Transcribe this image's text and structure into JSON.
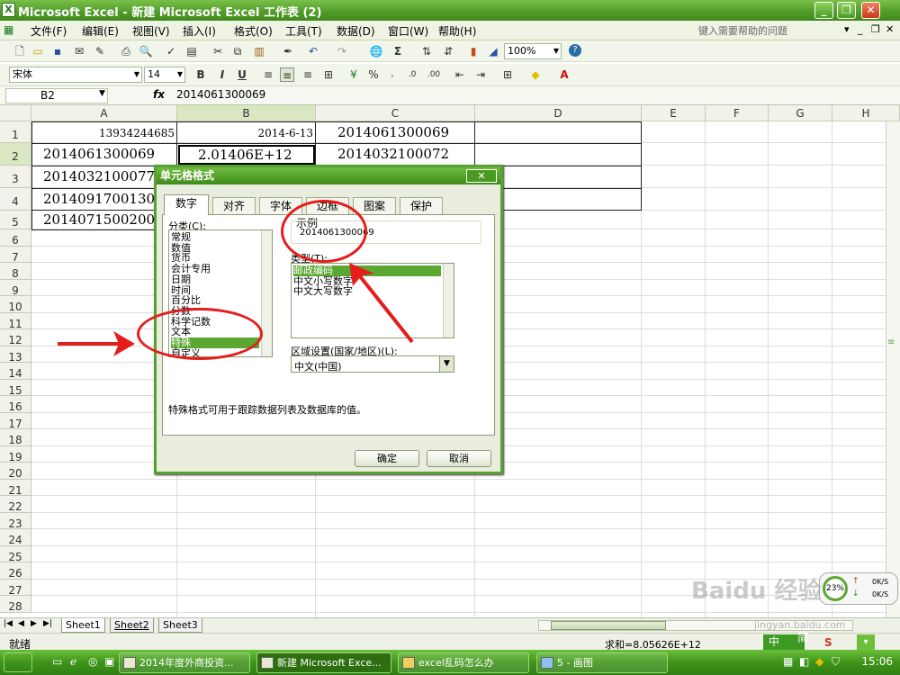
{
  "window": {
    "title": "Microsoft Excel - 新建 Microsoft Excel 工作表 (2)",
    "app_icon": "X"
  },
  "menu": {
    "items": [
      "文件(F)",
      "编辑(E)",
      "视图(V)",
      "插入(I)",
      "格式(O)",
      "工具(T)",
      "数据(D)",
      "窗口(W)",
      "帮助(H)"
    ],
    "help_placeholder": "键入需要帮助的问题"
  },
  "toolbar": {
    "zoom": "100%",
    "font": "宋体",
    "font_size": "14"
  },
  "formula_bar": {
    "name_box": "B2",
    "fx": "fx",
    "value": "2014061300069"
  },
  "grid": {
    "columns": [
      "A",
      "B",
      "C",
      "D",
      "E",
      "F",
      "G",
      "H"
    ],
    "rows": [
      "1",
      "2",
      "3",
      "4",
      "5",
      "6",
      "7",
      "8",
      "9",
      "10",
      "11",
      "12",
      "13",
      "14",
      "15",
      "16",
      "17",
      "18",
      "19",
      "20",
      "21",
      "22",
      "23",
      "24",
      "25",
      "26",
      "27",
      "28"
    ],
    "cells": {
      "A1": "13934244685",
      "B1": "2014-6-13",
      "C1": "2014061300069",
      "A2": "2014061300069",
      "B2": "2.01406E+12",
      "C2": "2014032100072",
      "A3": "2014032100077",
      "A4": "2014091700130",
      "A5": "2014071500200"
    }
  },
  "dialog": {
    "title": "单元格格式",
    "close": "✕",
    "tabs": [
      "数字",
      "对齐",
      "字体",
      "边框",
      "图案",
      "保护"
    ],
    "category_label": "分类(C):",
    "categories": [
      "常规",
      "数值",
      "货币",
      "会计专用",
      "日期",
      "时间",
      "百分比",
      "分数",
      "科学记数",
      "文本",
      "特殊",
      "自定义"
    ],
    "selected_category": "特殊",
    "sample_label": "示例",
    "sample_value": "2014061300069",
    "type_label": "类型(T):",
    "types": [
      "邮政编码",
      "中文小写数字",
      "中文大写数字"
    ],
    "locale_label": "区域设置(国家/地区)(L):",
    "locale_value": "中文(中国)",
    "description": "特殊格式可用于跟踪数据列表及数据库的值。",
    "ok": "确定",
    "cancel": "取消"
  },
  "sheets": [
    "Sheet1",
    "Sheet2",
    "Sheet3"
  ],
  "status": {
    "left": "就绪",
    "sum": "求和=8.05626E+12"
  },
  "taskbar": {
    "tasks": [
      "2014年度外商投资...",
      "新建 Microsoft Exce...",
      "excel乱码怎么办",
      "5 - 画图"
    ],
    "clock": "15:06"
  },
  "net": {
    "percent": "23%",
    "up": "0K/S",
    "down": "0K/S"
  },
  "watermark": {
    "main": "Baidu 经验",
    "sub": "jingyan.baidu.com"
  },
  "ime": {
    "label": "中",
    "mode": "简"
  }
}
